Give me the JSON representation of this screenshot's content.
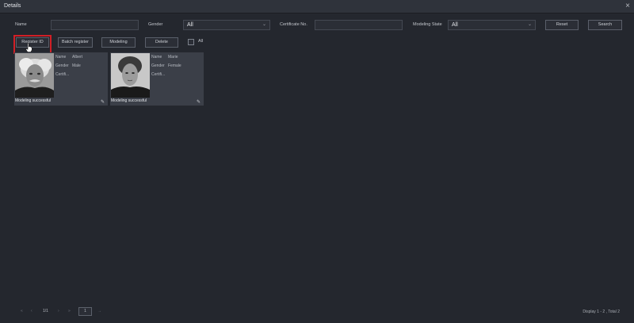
{
  "window": {
    "title": "Details",
    "close_glyph": "×"
  },
  "filters": {
    "name_label": "Name",
    "name_value": "",
    "gender_label": "Gender",
    "gender_value": "All",
    "certificate_label": "Certificate No.",
    "certificate_value": "",
    "modeling_state_label": "Modeling State",
    "modeling_state_value": "All",
    "reset_label": "Reset",
    "search_label": "Search"
  },
  "toolbar": {
    "register_label": "Register ID",
    "batch_label": "Batch register",
    "modeling_label": "Modeling",
    "delete_label": "Delete",
    "all_label": "All"
  },
  "cards": [
    {
      "name_key": "Name",
      "name_value": "Albert",
      "gender_key": "Gender",
      "gender_value": "Male",
      "cert_key": "Certifi...",
      "status": "Modeling successful",
      "photo_icon": "portrait-photo",
      "edit_icon": "pencil-icon"
    },
    {
      "name_key": "Name",
      "name_value": "Marie",
      "gender_key": "Gender",
      "gender_value": "Female",
      "cert_key": "Certifi...",
      "status": "Modeling successful",
      "photo_icon": "portrait-photo",
      "edit_icon": "pencil-icon"
    }
  ],
  "pagination": {
    "page_indicator": "1/1",
    "page_input": "1",
    "summary": "Display 1 - 2 , Total 2"
  },
  "colors": {
    "background": "#24272e",
    "highlight": "#d11f26",
    "card": "#3b3f48"
  }
}
